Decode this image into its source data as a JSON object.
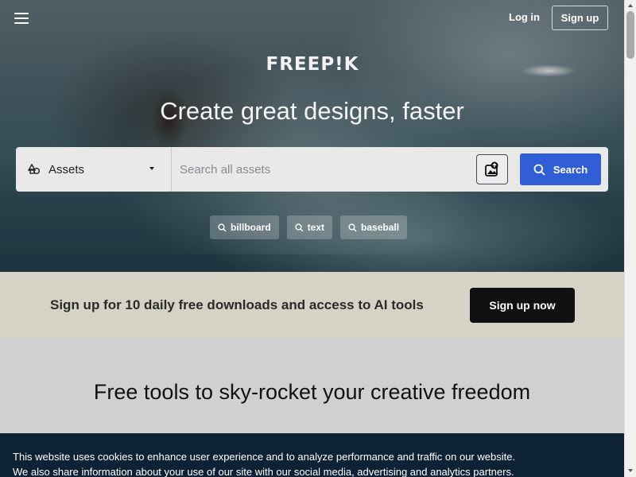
{
  "header": {
    "menu_icon": "hamburger-menu-icon",
    "login_label": "Log in",
    "signup_label": "Sign up"
  },
  "hero": {
    "logo_text": "FREEP!K",
    "title": "Create great designs, faster",
    "search": {
      "asset_type": "Assets",
      "asset_icon": "assets-icon",
      "placeholder": "Search all assets",
      "value": "",
      "image_search_icon": "image-search-icon",
      "button_label": "Search",
      "button_icon": "search-icon"
    },
    "tags": [
      {
        "label": "billboard",
        "icon": "search-icon"
      },
      {
        "label": "text",
        "icon": "search-icon"
      },
      {
        "label": "baseball",
        "icon": "search-icon"
      }
    ]
  },
  "promo": {
    "text": "Sign up for 10 daily free downloads and access to AI tools",
    "button_label": "Sign up now"
  },
  "tools": {
    "title": "Free tools to sky-rocket your creative freedom"
  },
  "cookie_banner": {
    "line1": "This website uses cookies to enhance user experience and to analyze performance and traffic on our website.",
    "line2": "We also share information about your use of our site with our social media, advertising and analytics partners."
  },
  "colors": {
    "search_button": "#2f5ed6",
    "promo_background": "#d6d2c5",
    "cookie_background": "#0e2235",
    "signup_now_button": "#111111"
  }
}
